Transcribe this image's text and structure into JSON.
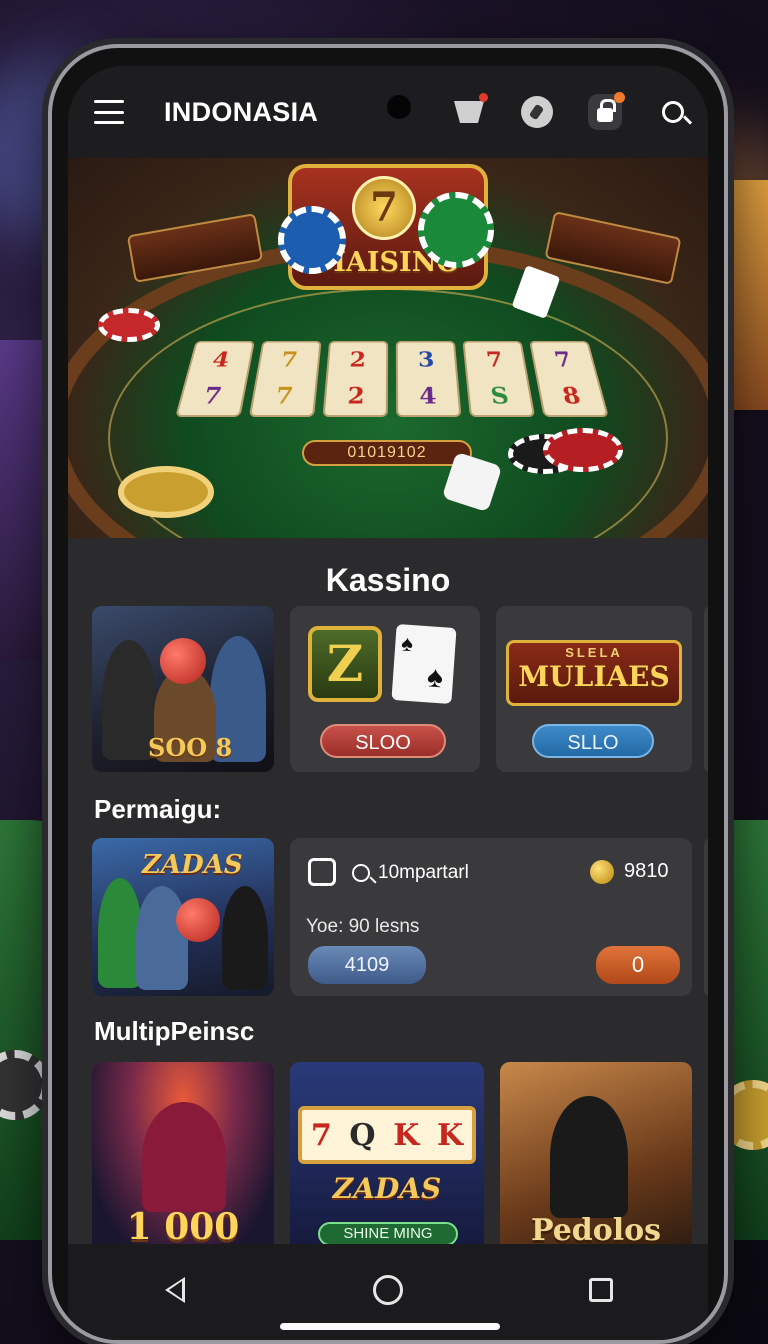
{
  "header": {
    "title": "INDONASIA",
    "icons": [
      "menu-icon",
      "cart-icon",
      "disc-icon",
      "lock-icon",
      "search-icon"
    ]
  },
  "hero": {
    "logo_text": "MAISINO",
    "logo_number": "7",
    "counter": "01019102",
    "tiles": [
      {
        "top": "4",
        "bottom": "7"
      },
      {
        "top": "7",
        "bottom": "7"
      },
      {
        "top": "2",
        "bottom": "2"
      },
      {
        "top": "3",
        "bottom": "4"
      },
      {
        "top": "7",
        "bottom": "S"
      },
      {
        "top": "7",
        "bottom": "8"
      }
    ]
  },
  "sections": {
    "kassino": {
      "title": "Kassino",
      "cards": [
        {
          "label": "SOO 8"
        },
        {
          "badge": "Z",
          "button": "SLOO"
        },
        {
          "banner_top": "SLELA",
          "banner_main": "MULIAES",
          "button": "SLLO"
        }
      ]
    },
    "permaigu": {
      "title": "Permaigu:",
      "card1_label": "ZADAS",
      "panel": {
        "search_text": "10mpartarl",
        "coin_value": "9810",
        "info": "Yoe:  90 lesns",
        "left_button": "4109",
        "right_button": "0"
      }
    },
    "multi": {
      "title": "MultipPeinsc",
      "cards": [
        {
          "label": "1 000"
        },
        {
          "reels": [
            "7",
            "Q",
            "K",
            "K"
          ],
          "logo": "ZADAS",
          "bar": "SHINE MING"
        },
        {
          "label": "Pedolos"
        }
      ]
    }
  },
  "nav": {
    "icons": [
      "back-icon",
      "home-icon",
      "recents-icon"
    ]
  },
  "colors": {
    "screen_bg": "#2b2b2d",
    "card_bg": "#3a3a3c",
    "accent_gold": "#e0b23c",
    "button_red": "#b03a32",
    "button_blue": "#2f7ab8",
    "button_orange": "#c85a26"
  }
}
